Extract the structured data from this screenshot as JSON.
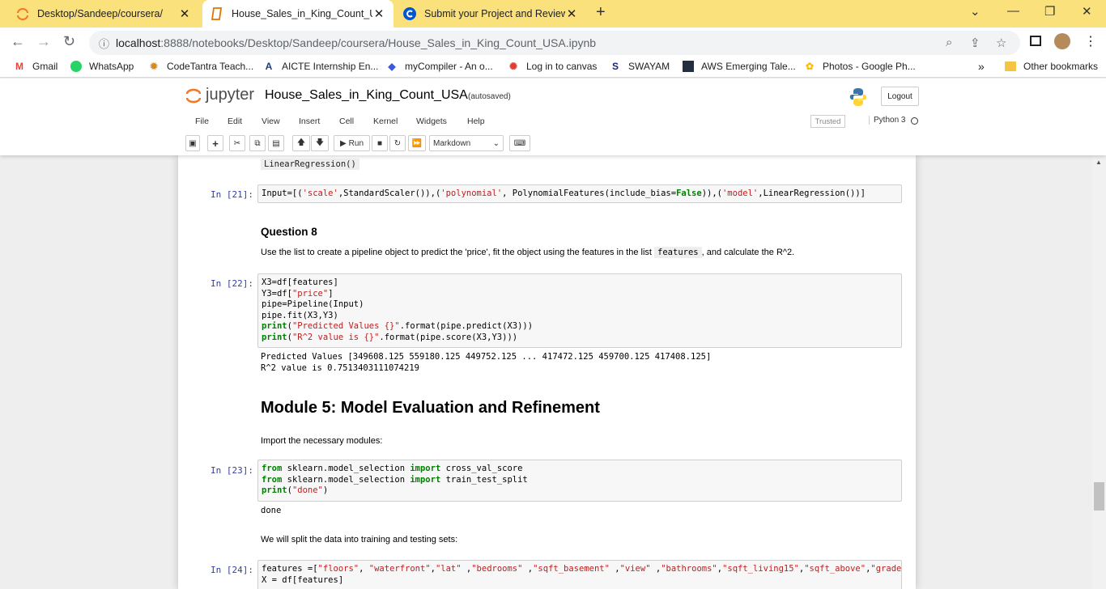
{
  "browser": {
    "tabs": [
      {
        "title": "Desktop/Sandeep/coursera/",
        "close": "✕"
      },
      {
        "title": "House_Sales_in_King_Count_USA",
        "close": "✕"
      },
      {
        "title": "Submit your Project and Review",
        "close": "✕"
      }
    ],
    "new_tab": "+",
    "url_host": "localhost",
    "url_rest": ":8888/notebooks/Desktop/Sandeep/coursera/House_Sales_in_King_Count_USA.ipynb",
    "bookmarks": [
      "Gmail",
      "WhatsApp",
      "CodeTantra Teach...",
      "AICTE Internship En...",
      "myCompiler - An o...",
      "Log in to canvas",
      "SWAYAM",
      "AWS Emerging Tale...",
      "Photos - Google Ph..."
    ],
    "bookmarks_overflow": "»",
    "other_bookmarks": "Other bookmarks"
  },
  "jupyter": {
    "logo_text": "jupyter",
    "notebook_title": "House_Sales_in_King_Count_USA",
    "autosave": "(autosaved)",
    "logout": "Logout",
    "menus": [
      "File",
      "Edit",
      "View",
      "Insert",
      "Cell",
      "Kernel",
      "Widgets",
      "Help"
    ],
    "trusted": "Trusted",
    "kernel": "Python 3",
    "run_label": "Run",
    "cell_type": "Markdown"
  },
  "cells": {
    "prev_output": "LinearRegression()",
    "c21_prompt": "In [21]:",
    "c22_prompt": "In [22]:",
    "c23_prompt": "In [23]:",
    "c24_prompt": "In [24]:",
    "question8": "Question 8",
    "q8_text_a": "Use the list to create a pipeline object to predict the 'price', fit the object using the features in the list",
    "q8_code": "features",
    "q8_text_b": ", and calculate the R^2.",
    "c22_out1": "Predicted Values [349608.125 559180.125 449752.125 ... 417472.125 459700.125 417408.125]",
    "c22_out2": "R^2 value is 0.7513403111074219",
    "module5": "Module 5: Model Evaluation and Refinement",
    "import_text": "Import the necessary modules:",
    "c23_out": "done",
    "split_text": "We will split the data into training and testing sets:"
  }
}
